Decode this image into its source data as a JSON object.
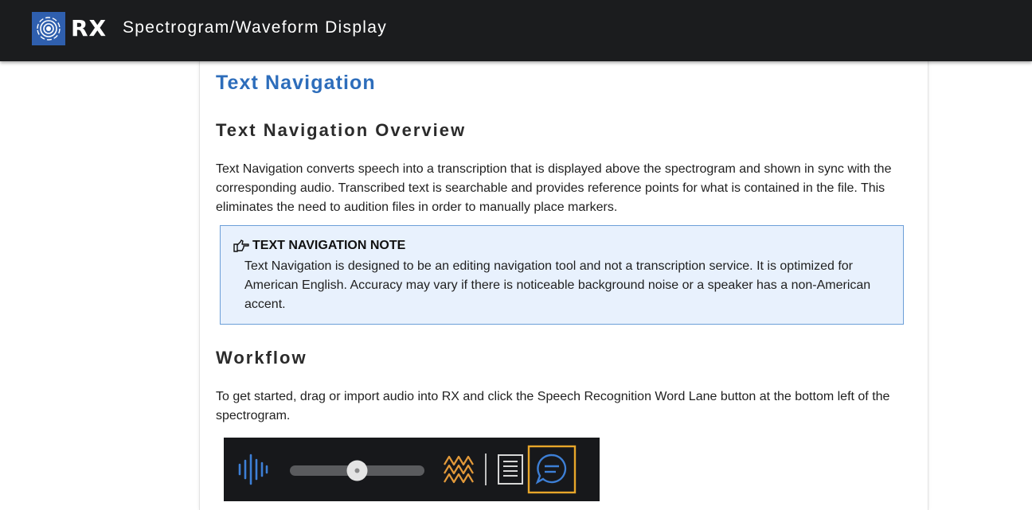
{
  "header": {
    "logo_text": "RX",
    "title": "Spectrogram/Waveform Display"
  },
  "page": {
    "title": "Text Navigation",
    "overview_heading": "Text Navigation Overview",
    "overview_text": "Text Navigation converts speech into a transcription that is displayed above the spectrogram and shown in sync with the corresponding audio. Transcribed text is searchable and provides reference points for what is contained in the file. This eliminates the need to audition files in order to manually place markers.",
    "note": {
      "title": "TEXT NAVIGATION NOTE",
      "body": "Text Navigation is designed to be an editing navigation tool and not a transcription service. It is optimized for American English. Accuracy may vary if there is noticeable background noise or a speaker has a non-American accent."
    },
    "workflow_heading": "Workflow",
    "workflow_text": "To get started, drag or import audio into RX and click the Speech Recognition Word Lane button at the bottom left of the spectrogram."
  },
  "toolbar_image": {
    "slider_level": 0.5,
    "icons": [
      "waveform-icon",
      "slider-thumb",
      "spectral-icon",
      "document-icon",
      "speech-bubble-icon"
    ],
    "colors": {
      "background": "#17181b",
      "waveform": "#3d7fd6",
      "spectral": "#e39a3a",
      "highlight": "#e8a62a",
      "document": "#d6d6d6"
    }
  }
}
